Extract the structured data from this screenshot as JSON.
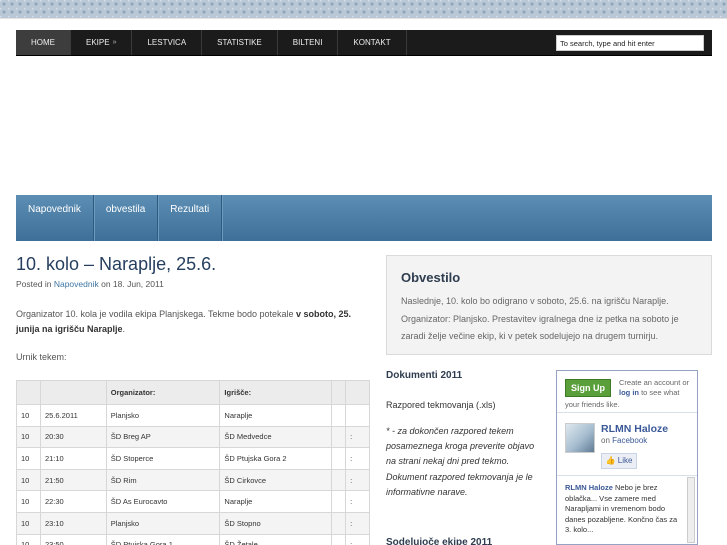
{
  "nav": {
    "items": [
      {
        "label": "HOME",
        "arrow": ""
      },
      {
        "label": "EKIPE",
        "arrow": "»"
      },
      {
        "label": "LESTVICA",
        "arrow": ""
      },
      {
        "label": "STATISTIKE",
        "arrow": ""
      },
      {
        "label": "BILTENI",
        "arrow": ""
      },
      {
        "label": "KONTAKT",
        "arrow": ""
      }
    ],
    "search_value": "To search, type and hit enter"
  },
  "subnav": {
    "items": [
      "Napovednik",
      "obvestila",
      "Rezultati"
    ]
  },
  "post": {
    "title": "10. kolo – Naraplje, 25.6.",
    "meta_prefix": "Posted in",
    "meta_category": "Napovednik",
    "meta_suffix": "on 18. Jun, 2011",
    "body_plain": "Organizator 10. kola je vodila ekipa Planjskega. Tekme bodo potekale ",
    "body_bold": "v soboto, 25. junija na igrišču Naraplje",
    "body_end": ".",
    "umik": "Urnik tekem:"
  },
  "schedule": {
    "headers": [
      "",
      "",
      "Organizator:",
      "Igrišče:",
      "",
      ""
    ],
    "rows": [
      [
        "10",
        "25.6.2011",
        "Planjsko",
        "Naraplje",
        "",
        ""
      ],
      [
        "10",
        "20:30",
        "ŠD Breg AP",
        "ŠD Medvedce",
        "",
        ":"
      ],
      [
        "10",
        "21:10",
        "ŠD Stoperce",
        "ŠD Ptujska Gora 2",
        "",
        ":"
      ],
      [
        "10",
        "21:50",
        "ŠD Rim",
        "ŠD Cirkovce",
        "",
        ":"
      ],
      [
        "10",
        "22:30",
        "ŠD As Eurocavto",
        "Naraplje",
        "",
        ":"
      ],
      [
        "10",
        "23:10",
        "Planjsko",
        "ŠD Stopno",
        "",
        ":"
      ],
      [
        "10",
        "23:50",
        "ŠD Ptujska Gora 1",
        "ŠD Žetale",
        "",
        ":"
      ]
    ]
  },
  "obvestilo": {
    "title": "Obvestilo",
    "text": "Naslednje, 10. kolo bo odigrano v soboto, 25.6. na igrišču Naraplje. Organizator: Planjsko. Prestavitev igralnega dne iz petka na soboto je zaradi želje večine ekip, ki v petek sodelujejo na drugem turnirju."
  },
  "sidebar": {
    "dokumenti_title": "Dokumenti 2011",
    "razpored_link": "Razpored tekmovanja (.xls)",
    "note": "* - za dokončen razpored tekem posameznega kroga preverite objavo na strani nekaj dni pred tekmo. Dokument razpored tekmovanja je le informativne narave.",
    "cut_heading": "Sodelujoče ekipe 2011"
  },
  "facebook": {
    "signup": "Sign Up",
    "create_prefix": "Create an account or",
    "login": "log in",
    "create_suffix": "to see what",
    "friends": "your friends like.",
    "page_name": "RLMN Haloze",
    "on_word": "on",
    "network": "Facebook",
    "like": "Like",
    "post_author": "RLMN Haloze",
    "post_text": "Nebo je brez oblačka... Vse zamere med Narapljami in vremenom bodo danes pozabljene. Končno čas za 3. kolo..."
  }
}
